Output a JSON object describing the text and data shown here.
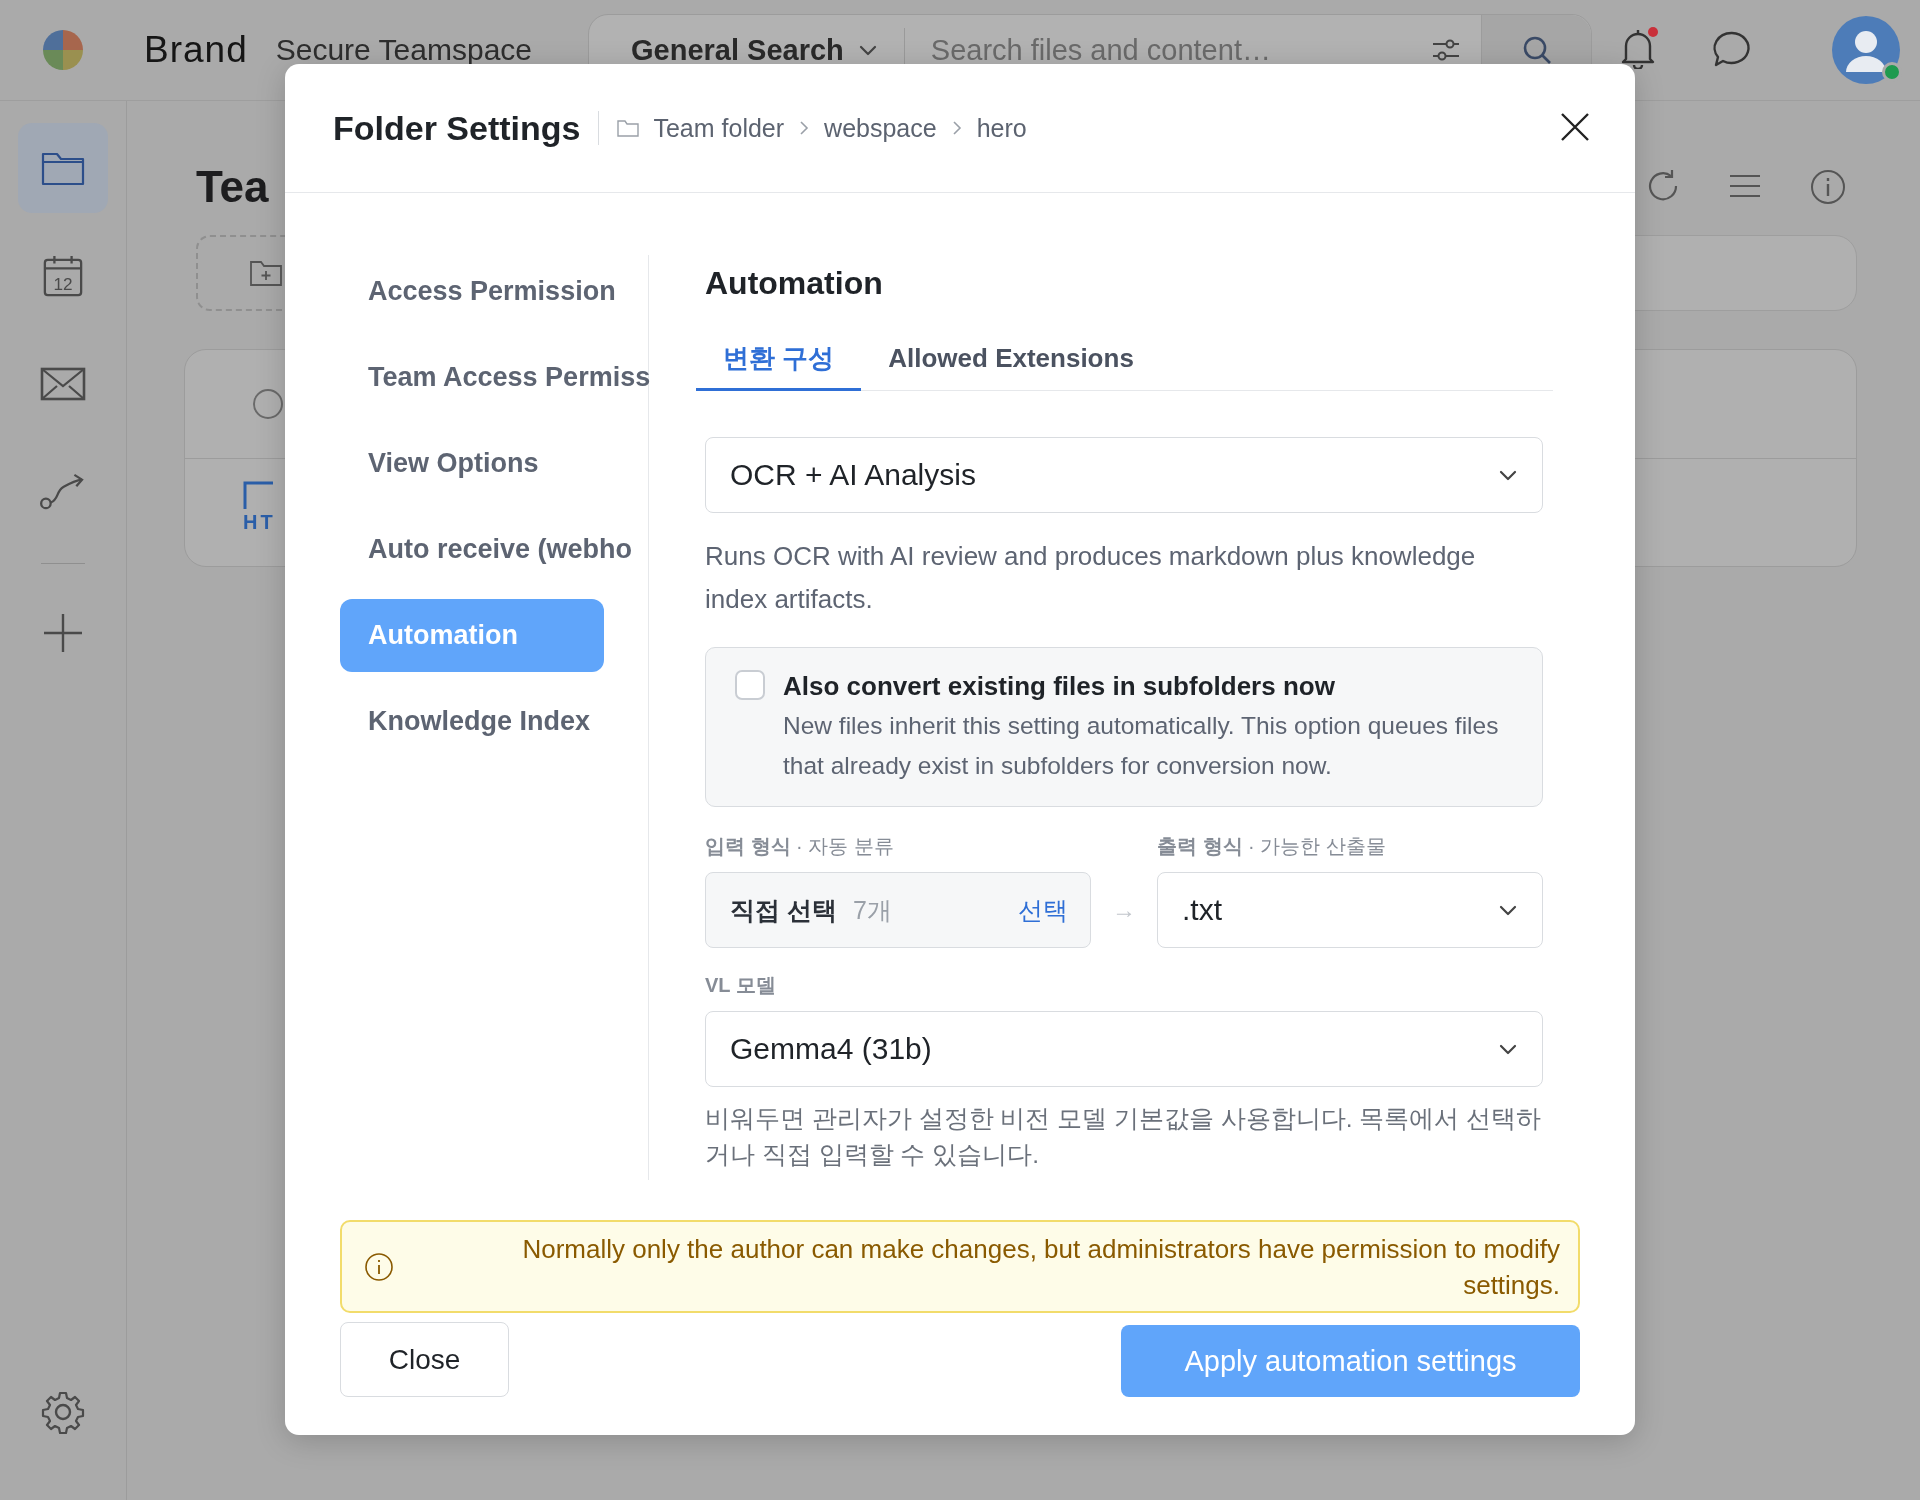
{
  "topbar": {
    "brand": "Brand",
    "workspace": "Secure Teamspace",
    "search_scope": "General Search",
    "search": {
      "placeholder": "Search files and content…"
    }
  },
  "rail": {
    "items": [
      {
        "kind": "folder",
        "selected": true
      },
      {
        "kind": "calendar",
        "label": "12",
        "selected": false
      },
      {
        "kind": "mail",
        "selected": false
      },
      {
        "kind": "route",
        "selected": false
      }
    ],
    "actions": [
      {
        "kind": "add"
      }
    ],
    "footer": [
      {
        "kind": "settings"
      }
    ]
  },
  "page": {
    "title": "Tea",
    "file_label": "HT",
    "row_checked": false
  },
  "dialog": {
    "title": "Folder Settings",
    "breadcrumb": [
      "Team folder",
      "webspace",
      "hero"
    ],
    "nav": [
      {
        "label": "Access Permission",
        "selected": false
      },
      {
        "label": "Team Access Permiss",
        "selected": false
      },
      {
        "label": "View Options",
        "selected": false
      },
      {
        "label": "Auto receive (webho",
        "selected": false
      },
      {
        "label": "Automation",
        "selected": true
      },
      {
        "label": "Knowledge Index",
        "selected": false
      }
    ],
    "section_title": "Automation",
    "tabs": [
      {
        "label": "변환 구성",
        "selected": true
      },
      {
        "label": "Allowed Extensions",
        "selected": false
      }
    ],
    "mode_select": {
      "value": "OCR + AI Analysis"
    },
    "mode_description": "Runs OCR with AI review and produces markdown plus knowledge index artifacts.",
    "subfolder_option": {
      "label": "Also convert existing files in subfolders now",
      "description": "New files inherit this setting automatically. This option queues files that already exist in subfolders for conversion now.",
      "checked": false
    },
    "input_format": {
      "label": "**입력 형식** · 자동 분류",
      "value": "직접 선택",
      "count": "7개",
      "action": "선택"
    },
    "arrow": "→",
    "output_format": {
      "label": "**출력 형식** · 가능한 산출물",
      "value": ".txt"
    },
    "vl_model": {
      "label": "VL 모델",
      "value": "Gemma4 (31b)",
      "help": "비워두면 관리자가 설정한 비전 모델 기본값을 사용합니다. 목록에서 선택하거나 직접 입력할 수 있습니다."
    },
    "notice": "Normally only the author can make changes, but administrators have permission to modify settings.",
    "buttons": {
      "close": "Close",
      "apply": "Apply automation settings"
    }
  }
}
